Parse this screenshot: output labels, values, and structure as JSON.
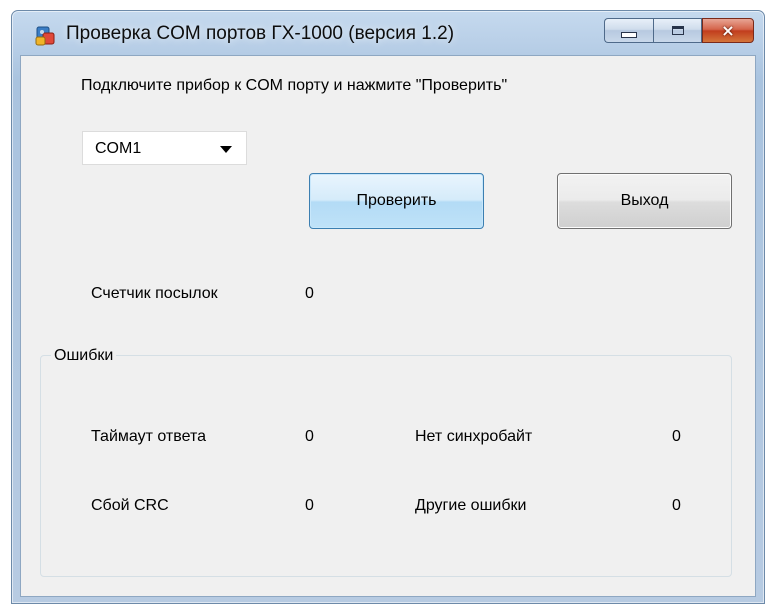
{
  "window": {
    "title": "Проверка COM портов ГХ-1000 (версия 1.2)",
    "icon": "app-icon"
  },
  "caption": {
    "minimize": "minimize-icon",
    "maximize": "maximize-icon",
    "close": "×"
  },
  "instruction": "Подключите прибор к COM порту и нажмите \"Проверить\"",
  "port_select": {
    "value": "COM1"
  },
  "buttons": {
    "check": "Проверить",
    "exit": "Выход"
  },
  "counter": {
    "label": "Счетчик посылок",
    "value": "0"
  },
  "errors": {
    "title": "Ошибки",
    "timeout": {
      "label": "Таймаут ответа",
      "value": "0"
    },
    "no_sync": {
      "label": "Нет синхробайт",
      "value": "0"
    },
    "crc": {
      "label": "Сбой CRC",
      "value": "0"
    },
    "other": {
      "label": "Другие ошибки",
      "value": "0"
    }
  },
  "colors": {
    "accent_button": "#bfe2f8",
    "close_button": "#c13d1e",
    "frame": "#b6cde6"
  }
}
